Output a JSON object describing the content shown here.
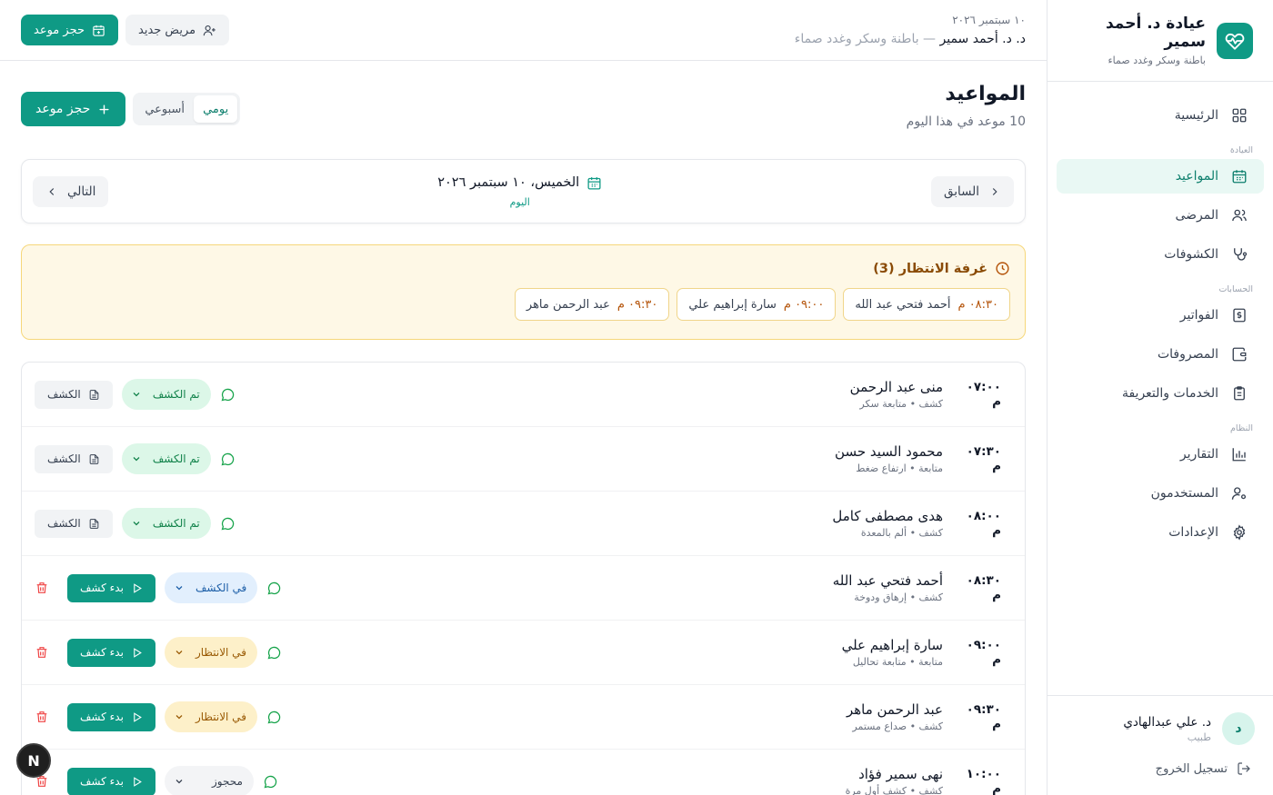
{
  "brand": {
    "title": "عيادة د. أحمد سمير",
    "subtitle": "باطنة وسكر وغدد صماء"
  },
  "nav": {
    "home": "الرئيسية",
    "section_clinic": "العيادة",
    "appointments": "المواعيد",
    "patients": "المرضى",
    "visits": "الكشوفات",
    "section_accounts": "الحسابات",
    "invoices": "الفواتير",
    "expenses": "المصروفات",
    "services": "الخدمات والتعريفة",
    "section_system": "النظام",
    "reports": "التقارير",
    "users": "المستخدمون",
    "settings": "الإعدادات"
  },
  "user": {
    "initial": "د",
    "name": "د. علي عبدالهادي",
    "role": "طبيب",
    "logout": "تسجيل الخروج"
  },
  "topbar": {
    "date": "١٠ سبتمبر ٢٠٢٦",
    "doctor": "د. د. أحمد سمير",
    "separator": " — ",
    "specialty": "باطنة وسكر وغدد صماء",
    "new_patient": "مريض جديد",
    "book": "حجز موعد"
  },
  "page": {
    "title": "المواعيد",
    "subtitle": "10 موعد في هذا اليوم",
    "view_daily": "يومي",
    "view_weekly": "أسبوعي",
    "book": "حجز موعد"
  },
  "datebar": {
    "prev": "السابق",
    "next": "التالي",
    "date": "الخميس، ١٠ سبتمبر ٢٠٢٦",
    "today": "اليوم"
  },
  "waiting": {
    "title": "غرفة الانتظار (3)",
    "items": [
      {
        "time": "٠٨:٣٠ م",
        "name": "أحمد فتحي عبد الله"
      },
      {
        "time": "٠٩:٠٠ م",
        "name": "سارة إبراهيم علي"
      },
      {
        "time": "٠٩:٣٠ م",
        "name": "عبد الرحمن ماهر"
      }
    ]
  },
  "labels": {
    "visit": "الكشف",
    "start_visit": "بدء كشف"
  },
  "appointments": [
    {
      "time": "٠٧:٠٠ م",
      "name": "منى عبد الرحمن",
      "meta": "كشف • متابعة سكر",
      "status": "تم الكشف"
    },
    {
      "time": "٠٧:٣٠ م",
      "name": "محمود السيد حسن",
      "meta": "متابعة • ارتفاع ضغط",
      "status": "تم الكشف"
    },
    {
      "time": "٠٨:٠٠ م",
      "name": "هدى مصطفى كامل",
      "meta": "كشف • ألم بالمعدة",
      "status": "تم الكشف"
    },
    {
      "time": "٠٨:٣٠ م",
      "name": "أحمد فتحي عبد الله",
      "meta": "كشف • إرهاق ودوخة",
      "status": "في الكشف"
    },
    {
      "time": "٠٩:٠٠ م",
      "name": "سارة إبراهيم علي",
      "meta": "متابعة • متابعة تحاليل",
      "status": "في الانتظار"
    },
    {
      "time": "٠٩:٣٠ م",
      "name": "عبد الرحمن ماهر",
      "meta": "كشف • صداع مستمر",
      "status": "في الانتظار"
    },
    {
      "time": "١٠:٠٠ م",
      "name": "نهى سمير فؤاد",
      "meta": "كشف • كشف أول مرة",
      "status": "محجوز"
    }
  ],
  "fab": "N"
}
